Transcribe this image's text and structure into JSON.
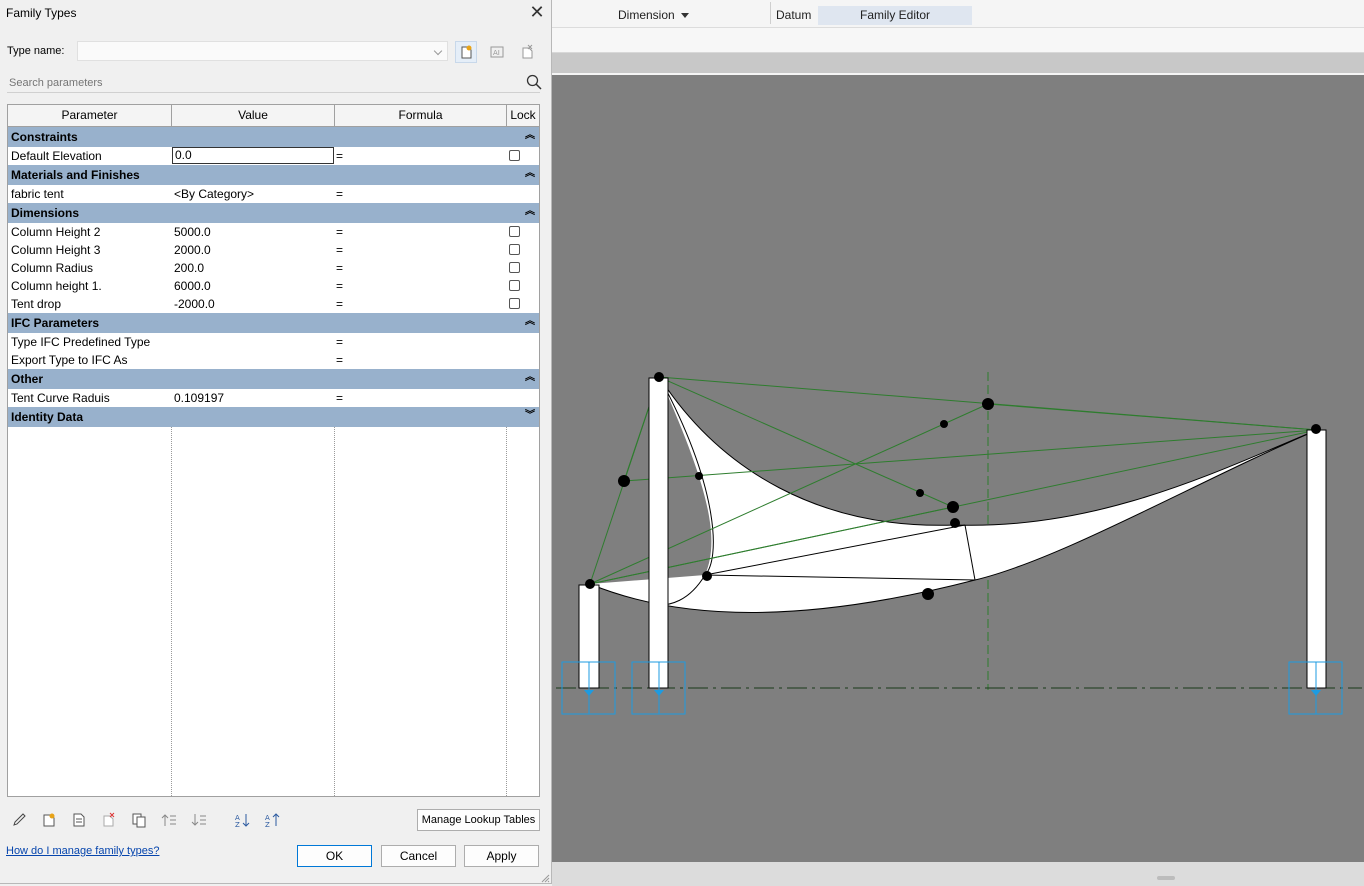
{
  "dialog": {
    "title": "Family Types",
    "type_name_label": "Type name:",
    "type_name_value": "",
    "search_placeholder": "Search parameters",
    "columns": [
      "Parameter",
      "Value",
      "Formula",
      "Lock"
    ],
    "groups": [
      {
        "label": "Constraints",
        "collapsed": false,
        "rows": [
          {
            "name": "Default Elevation",
            "value": "0.0",
            "formula": "=",
            "lock": true,
            "editing": true
          }
        ]
      },
      {
        "label": "Materials and Finishes",
        "collapsed": false,
        "rows": [
          {
            "name": "fabric tent",
            "value": "<By Category>",
            "formula": "=",
            "lock": false
          }
        ]
      },
      {
        "label": "Dimensions",
        "collapsed": false,
        "rows": [
          {
            "name": "Column Height 2",
            "value": "5000.0",
            "formula": "=",
            "lock": true
          },
          {
            "name": "Column Height 3",
            "value": "2000.0",
            "formula": "=",
            "lock": true
          },
          {
            "name": "Column Radius",
            "value": "200.0",
            "formula": "=",
            "lock": true
          },
          {
            "name": "Column height 1.",
            "value": "6000.0",
            "formula": "=",
            "lock": true
          },
          {
            "name": "Tent drop",
            "value": "-2000.0",
            "formula": "=",
            "lock": true
          }
        ]
      },
      {
        "label": "IFC Parameters",
        "collapsed": false,
        "rows": [
          {
            "name": "Type IFC Predefined Type",
            "value": "",
            "formula": "=",
            "lock": false
          },
          {
            "name": "Export Type to IFC As",
            "value": "",
            "formula": "=",
            "lock": false
          }
        ]
      },
      {
        "label": "Other",
        "collapsed": false,
        "rows": [
          {
            "name": "Tent Curve Raduis",
            "value": "0.109197",
            "formula": "=",
            "lock": false
          }
        ]
      },
      {
        "label": "Identity Data",
        "collapsed": true,
        "rows": []
      }
    ],
    "manage_lookup_label": "Manage Lookup Tables",
    "help_link": "How do I manage family types?",
    "ok_label": "OK",
    "cancel_label": "Cancel",
    "apply_label": "Apply"
  },
  "ribbon": {
    "dimension_label": "Dimension",
    "datum_label": "Datum",
    "family_editor_label": "Family Editor"
  },
  "icons": {
    "new_type": "new-type-icon",
    "rename_type": "rename-type-icon",
    "delete_type": "delete-type-icon",
    "search": "search-icon"
  },
  "colors": {
    "group_header": "#98b1cc",
    "canvas": "#7f7f7f",
    "ref_line": "#2e7d2e",
    "connector": "#1e9be0"
  }
}
